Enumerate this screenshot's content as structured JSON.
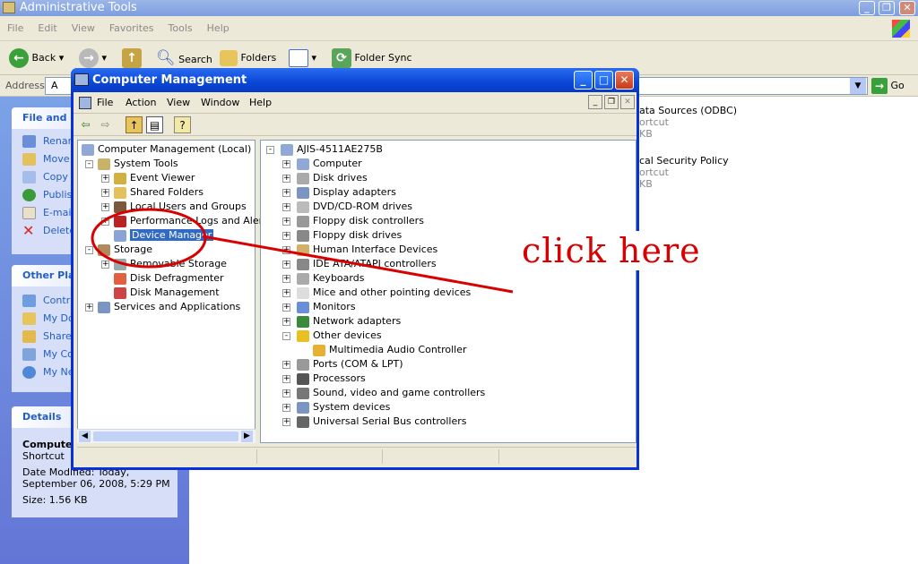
{
  "explorer": {
    "title": "Administrative Tools",
    "menu": [
      "File",
      "Edit",
      "View",
      "Favorites",
      "Tools",
      "Help"
    ],
    "toolbar": {
      "back": "Back",
      "search": "Search",
      "folders": "Folders",
      "folder_sync": "Folder Sync"
    },
    "address_label": "Address",
    "address_value": "A",
    "go_label": "Go",
    "file_tasks": {
      "header": "File and F",
      "items": [
        "Renam",
        "Move",
        "Copy",
        "Publis",
        "E-mail",
        "Delete"
      ]
    },
    "other_places": {
      "header": "Other Pla",
      "items": [
        "Contr",
        "My Do",
        "Share",
        "My Co",
        "My Ne"
      ]
    },
    "details": {
      "header": "Details",
      "name": "Compute",
      "type": "Shortcut",
      "modified_line1": "Date Modified: Today,",
      "modified_line2": "September 06, 2008, 5:29 PM",
      "size": "Size: 1.56 KB"
    },
    "files": [
      {
        "name": "ata Sources (ODBC)",
        "type": "ortcut",
        "size": "KB"
      },
      {
        "name": "cal Security Policy",
        "type": "ortcut",
        "size": "KB"
      }
    ]
  },
  "cm": {
    "title": "Computer Management",
    "menu": [
      "File",
      "Action",
      "View",
      "Window",
      "Help"
    ],
    "tree": [
      {
        "label": "Computer Management (Local)",
        "depth": 0,
        "exp": "",
        "selected": false
      },
      {
        "label": "System Tools",
        "depth": 1,
        "exp": "-",
        "selected": false
      },
      {
        "label": "Event Viewer",
        "depth": 2,
        "exp": "+",
        "selected": false
      },
      {
        "label": "Shared Folders",
        "depth": 2,
        "exp": "+",
        "selected": false
      },
      {
        "label": "Local Users and Groups",
        "depth": 2,
        "exp": "+",
        "selected": false
      },
      {
        "label": "Performance Logs and Alerts",
        "depth": 2,
        "exp": "+",
        "selected": false
      },
      {
        "label": "Device Manager",
        "depth": 2,
        "exp": "",
        "selected": true
      },
      {
        "label": "Storage",
        "depth": 1,
        "exp": "-",
        "selected": false
      },
      {
        "label": "Removable Storage",
        "depth": 2,
        "exp": "+",
        "selected": false
      },
      {
        "label": "Disk Defragmenter",
        "depth": 2,
        "exp": "",
        "selected": false
      },
      {
        "label": "Disk Management",
        "depth": 2,
        "exp": "",
        "selected": false
      },
      {
        "label": "Services and Applications",
        "depth": 1,
        "exp": "+",
        "selected": false
      }
    ],
    "devices_root": "AJIS-4511AE275B",
    "devices": [
      {
        "label": "Computer",
        "exp": "+",
        "depth": 1
      },
      {
        "label": "Disk drives",
        "exp": "+",
        "depth": 1
      },
      {
        "label": "Display adapters",
        "exp": "+",
        "depth": 1
      },
      {
        "label": "DVD/CD-ROM drives",
        "exp": "+",
        "depth": 1
      },
      {
        "label": "Floppy disk controllers",
        "exp": "+",
        "depth": 1
      },
      {
        "label": "Floppy disk drives",
        "exp": "+",
        "depth": 1
      },
      {
        "label": "Human Interface Devices",
        "exp": "+",
        "depth": 1
      },
      {
        "label": "IDE ATA/ATAPI controllers",
        "exp": "+",
        "depth": 1
      },
      {
        "label": "Keyboards",
        "exp": "+",
        "depth": 1
      },
      {
        "label": "Mice and other pointing devices",
        "exp": "+",
        "depth": 1
      },
      {
        "label": "Monitors",
        "exp": "+",
        "depth": 1
      },
      {
        "label": "Network adapters",
        "exp": "+",
        "depth": 1
      },
      {
        "label": "Other devices",
        "exp": "-",
        "depth": 1
      },
      {
        "label": "Multimedia Audio Controller",
        "exp": "",
        "depth": 2
      },
      {
        "label": "Ports (COM & LPT)",
        "exp": "+",
        "depth": 1
      },
      {
        "label": "Processors",
        "exp": "+",
        "depth": 1
      },
      {
        "label": "Sound, video and game controllers",
        "exp": "+",
        "depth": 1
      },
      {
        "label": "System devices",
        "exp": "+",
        "depth": 1
      },
      {
        "label": "Universal Serial Bus controllers",
        "exp": "+",
        "depth": 1
      }
    ]
  },
  "annotation": "click here",
  "colors": {
    "xp_blue": "#0a47d6",
    "annotation_red": "#d80000",
    "selection": "#316ac5"
  }
}
